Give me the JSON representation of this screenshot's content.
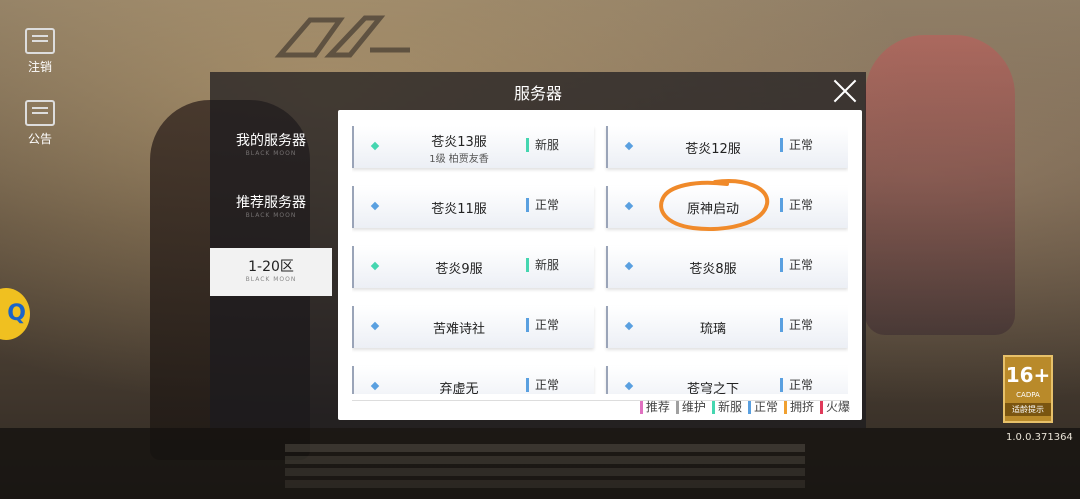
{
  "side": {
    "logout_label": "注销",
    "notice_label": "公告"
  },
  "panel": {
    "title": "服务器",
    "tabs": [
      {
        "label": "我的服务器",
        "sub": "BLACK MOON",
        "active": false
      },
      {
        "label": "推荐服务器",
        "sub": "BLACK MOON",
        "active": false
      },
      {
        "label": "1-20区",
        "sub": "BLACK MOON",
        "active": true
      }
    ]
  },
  "servers": [
    {
      "name": "苍炎13服",
      "meta": "1级 柏贾友香",
      "status": "新服",
      "color": "#45d6b0"
    },
    {
      "name": "苍炎12服",
      "meta": "",
      "status": "正常",
      "color": "#5aa0e0"
    },
    {
      "name": "苍炎11服",
      "meta": "",
      "status": "正常",
      "color": "#5aa0e0"
    },
    {
      "name": "原神启动",
      "meta": "",
      "status": "正常",
      "color": "#5aa0e0"
    },
    {
      "name": "苍炎9服",
      "meta": "",
      "status": "新服",
      "color": "#45d6b0"
    },
    {
      "name": "苍炎8服",
      "meta": "",
      "status": "正常",
      "color": "#5aa0e0"
    },
    {
      "name": "苦难诗社",
      "meta": "",
      "status": "正常",
      "color": "#5aa0e0"
    },
    {
      "name": "琉璃",
      "meta": "",
      "status": "正常",
      "color": "#5aa0e0"
    },
    {
      "name": "弃虚无",
      "meta": "",
      "status": "正常",
      "color": "#5aa0e0"
    },
    {
      "name": "苍穹之下",
      "meta": "",
      "status": "正常",
      "color": "#5aa0e0"
    }
  ],
  "legend": [
    {
      "label": "推荐",
      "color": "#e070c0"
    },
    {
      "label": "维护",
      "color": "#a0a0a0"
    },
    {
      "label": "新服",
      "color": "#45d6b0"
    },
    {
      "label": "正常",
      "color": "#5aa0e0"
    },
    {
      "label": "拥挤",
      "color": "#f0a030"
    },
    {
      "label": "火爆",
      "color": "#e03a5a"
    }
  ],
  "badge": {
    "age": "16+",
    "org": "CADPA",
    "tip": "适龄提示"
  },
  "version": "1.0.0.371364"
}
